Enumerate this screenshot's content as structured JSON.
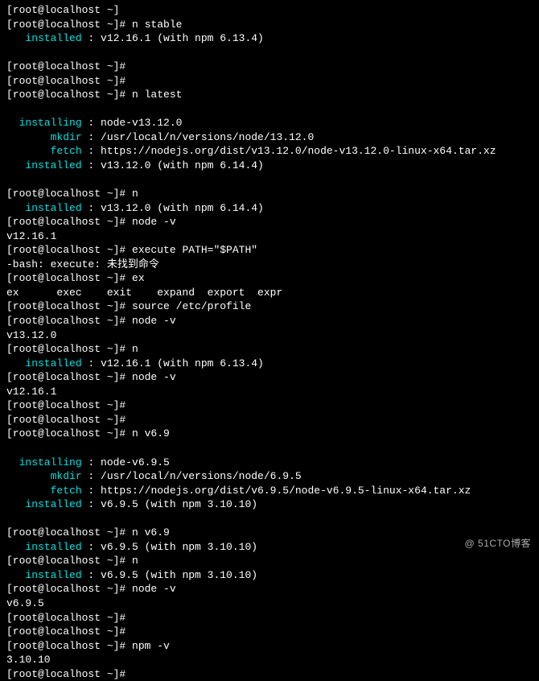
{
  "prompt": "[root@localhost ~]# ",
  "partial": "[root@localhost ~]",
  "bash_prefix": "-bash: ",
  "cmds": {
    "n_stable": "n stable",
    "n_latest": "n latest",
    "n": "n",
    "node_v": "node -v",
    "exec_path": "execute PATH=\"$PATH\"",
    "ex": "ex",
    "source_profile": "source /etc/profile",
    "n_v69": "n v6.9",
    "npm_v": "npm -v"
  },
  "labels": {
    "installed": "   installed",
    "installing": "  installing",
    "mkdir": "       mkdir",
    "fetch": "       fetch"
  },
  "values": {
    "sep": " : ",
    "v12161_npm": "v12.16.1 (with npm 6.13.4)",
    "v13120_npm": "v13.12.0 (with npm 6.14.4)",
    "v695_npm": "v6.9.5 (with npm 3.10.10)",
    "node_v13": "node-v13.12.0",
    "node_v695": "node-v6.9.5",
    "mkdir_v13": "/usr/local/n/versions/node/13.12.0",
    "mkdir_v695": "/usr/local/n/versions/node/6.9.5",
    "fetch_v13": "https://nodejs.org/dist/v13.12.0/node-v13.12.0-linux-x64.tar.xz",
    "fetch_v695": "https://nodejs.org/dist/v6.9.5/node-v6.9.5-linux-x64.tar.xz",
    "v12161": "v12.16.1",
    "v13120": "v13.12.0",
    "v695": "v6.9.5",
    "npm_31010": "3.10.10",
    "exec_notfound": "execute: 未找到命令",
    "ex_completions": "ex      exec    exit    expand  export  expr"
  },
  "watermark": "@ 51CTO博客"
}
